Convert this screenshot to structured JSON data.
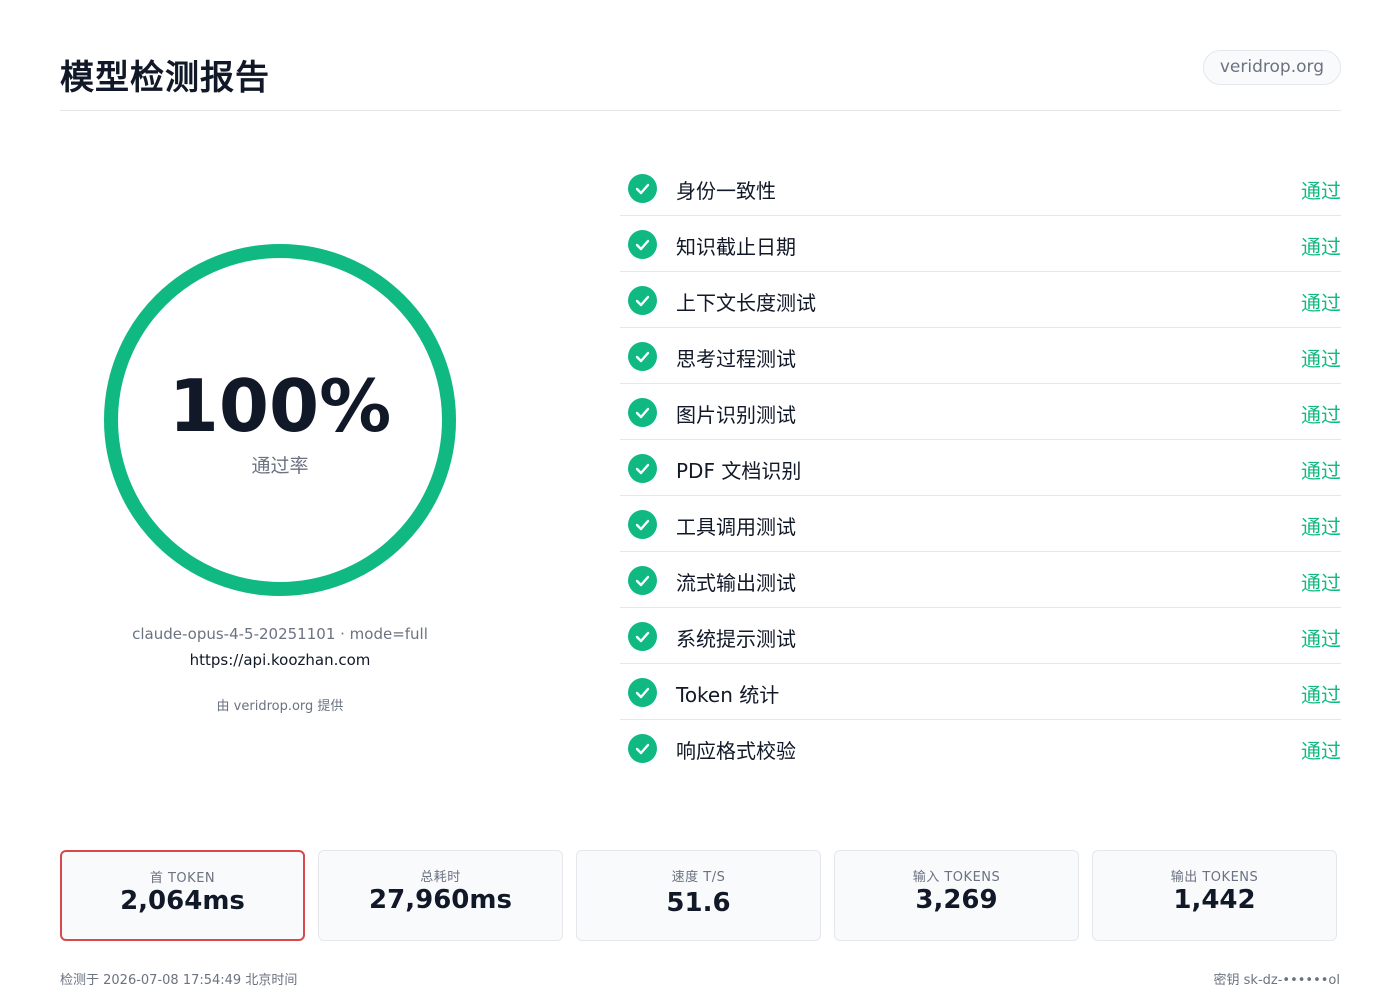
{
  "header": {
    "title": "模型检测报告",
    "domain_badge": "veridrop.org"
  },
  "gauge": {
    "value_text": "100%",
    "fraction": 1.0,
    "caption": "通过率",
    "color": "#10b981"
  },
  "meta": {
    "model_line": "claude-opus-4-5-20251101  ·  mode=full",
    "api_url": "https://api.koozhan.com",
    "powered_by": "由 veridrop.org 提供"
  },
  "checks": [
    {
      "label": "身份一致性",
      "status": "通过",
      "icon": "check-icon"
    },
    {
      "label": "知识截止日期",
      "status": "通过",
      "icon": "check-icon"
    },
    {
      "label": "上下文长度测试",
      "status": "通过",
      "icon": "check-icon"
    },
    {
      "label": "思考过程测试",
      "status": "通过",
      "icon": "check-icon"
    },
    {
      "label": "图片识别测试",
      "status": "通过",
      "icon": "check-icon"
    },
    {
      "label": "PDF 文档识别",
      "status": "通过",
      "icon": "check-icon"
    },
    {
      "label": "工具调用测试",
      "status": "通过",
      "icon": "check-icon"
    },
    {
      "label": "流式输出测试",
      "status": "通过",
      "icon": "check-icon"
    },
    {
      "label": "系统提示测试",
      "status": "通过",
      "icon": "check-icon"
    },
    {
      "label": "Token 统计",
      "status": "通过",
      "icon": "check-icon"
    },
    {
      "label": "响应格式校验",
      "status": "通过",
      "icon": "check-icon"
    }
  ],
  "stats": [
    {
      "label": "首 TOKEN",
      "value": "2,064ms",
      "highlight": true
    },
    {
      "label": "总耗时",
      "value": "27,960ms",
      "highlight": false
    },
    {
      "label": "速度 T/S",
      "value": "51.6",
      "highlight": false
    },
    {
      "label": "输入 TOKENS",
      "value": "3,269",
      "highlight": false
    },
    {
      "label": "输出 TOKENS",
      "value": "1,442",
      "highlight": false
    }
  ],
  "footer": {
    "left": "检测于 2026-07-08 17:54:49 北京时间",
    "right": "密钥 sk-dz-••••••ol"
  },
  "colors": {
    "accent": "#10b981",
    "highlight_border": "#d9484c"
  }
}
